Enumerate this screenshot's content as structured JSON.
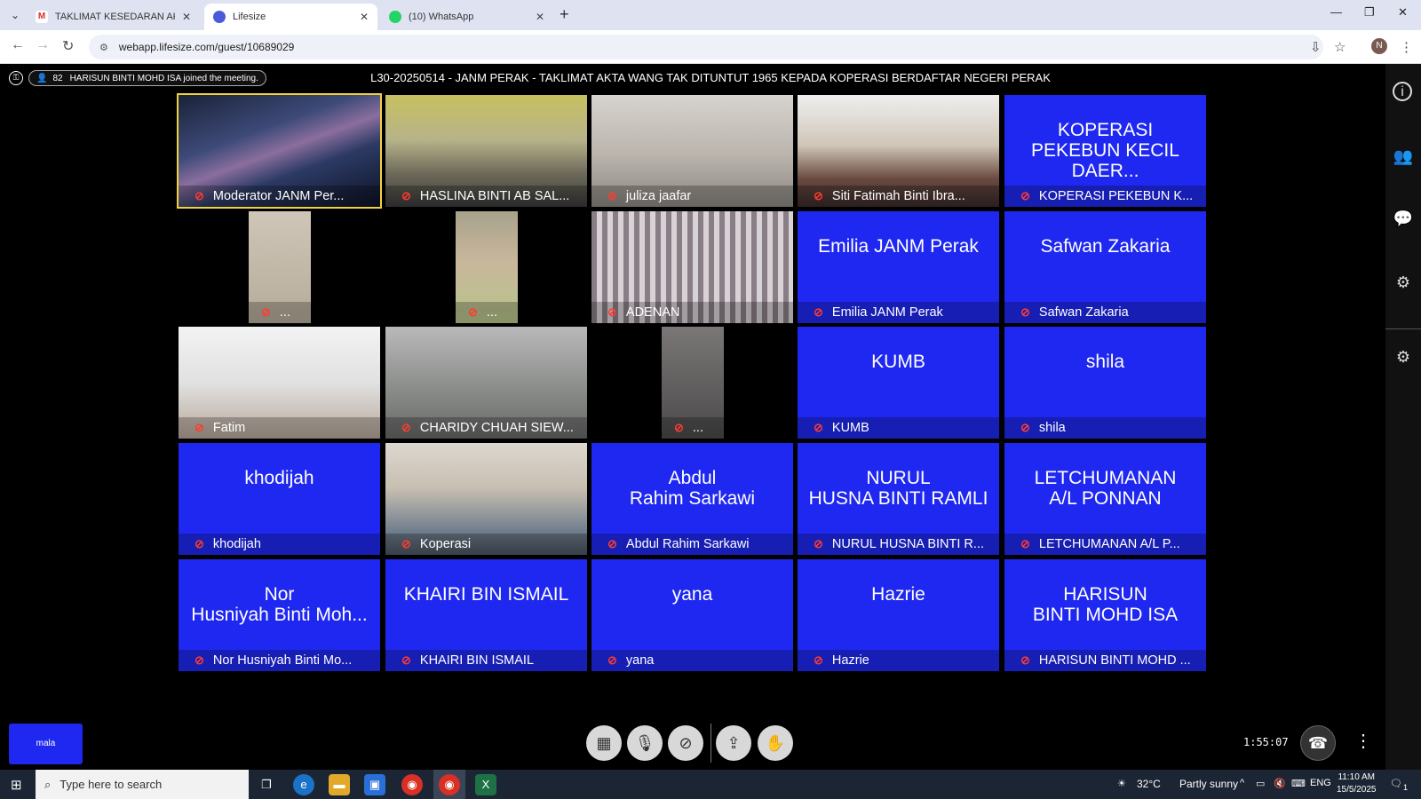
{
  "browser": {
    "tabs": [
      {
        "title": "TAKLIMAT KESEDARAN AKTA WANG",
        "icon": "gmail-icon",
        "color": "#d93025"
      },
      {
        "title": "Lifesize",
        "icon": "lifesize-icon",
        "color": "#4b5bd8"
      },
      {
        "title": "(10) WhatsApp",
        "icon": "whatsapp-icon",
        "color": "#25d366"
      }
    ],
    "url": "webapp.lifesize.com/guest/10689029",
    "profile_initial": "N"
  },
  "meeting": {
    "participant_count": "82",
    "join_notice": "HARISUN BINTI MOHD ISA joined the meeting.",
    "title": "L30-20250514 - JANM PERAK - TAKLIMAT AKTA WANG TAK DITUNTUT 1965 KEPADA KOPERASI BERDAFTAR NEGERI PERAK",
    "timer": "1:55:07",
    "self_view_name": "mala"
  },
  "participants": [
    {
      "name": "Moderator JANM Per...",
      "big": "",
      "type": "video",
      "scene": "galaxy"
    },
    {
      "name": "HASLINA BINTI AB SAL...",
      "big": "",
      "type": "video",
      "scene": "office"
    },
    {
      "name": "juliza jaafar",
      "big": "",
      "type": "video",
      "scene": "room"
    },
    {
      "name": "Siti Fatimah Binti Ibra...",
      "big": "",
      "type": "video",
      "scene": "face"
    },
    {
      "name": "KOPERASI PEKEBUN K...",
      "big": "KOPERASI\nPEKEBUN KECIL DAER...",
      "type": "blue"
    },
    {
      "name": "...",
      "big": "",
      "type": "video",
      "scene": "door"
    },
    {
      "name": "...",
      "big": "",
      "type": "video",
      "scene": "man"
    },
    {
      "name": "ADENAN",
      "big": "",
      "type": "video",
      "scene": "curtain"
    },
    {
      "name": "Emilia JANM Perak",
      "big": "Emilia JANM Perak",
      "type": "blue"
    },
    {
      "name": "Safwan Zakaria",
      "big": "Safwan Zakaria",
      "type": "blue"
    },
    {
      "name": "Fatim",
      "big": "",
      "type": "video",
      "scene": "ceiling"
    },
    {
      "name": "CHARIDY CHUAH SIEW...",
      "big": "",
      "type": "video",
      "scene": "stairs"
    },
    {
      "name": "...",
      "big": "",
      "type": "video",
      "scene": "dim"
    },
    {
      "name": "KUMB",
      "big": "KUMB",
      "type": "blue"
    },
    {
      "name": "shila",
      "big": "shila",
      "type": "blue"
    },
    {
      "name": "khodijah",
      "big": "khodijah",
      "type": "blue"
    },
    {
      "name": "Koperasi",
      "big": "",
      "type": "video",
      "scene": "hijab"
    },
    {
      "name": "Abdul Rahim Sarkawi",
      "big": "Abdul\nRahim Sarkawi",
      "type": "blue"
    },
    {
      "name": "NURUL HUSNA BINTI R...",
      "big": "NURUL\nHUSNA BINTI RAMLI",
      "type": "blue"
    },
    {
      "name": "LETCHUMANAN A/L P...",
      "big": "LETCHUMANAN\nA/L PONNAN",
      "type": "blue"
    },
    {
      "name": "Nor Husniyah Binti Mo...",
      "big": "Nor\nHusniyah Binti Moh...",
      "type": "blue"
    },
    {
      "name": "KHAIRI BIN ISMAIL",
      "big": "KHAIRI BIN ISMAIL",
      "type": "blue"
    },
    {
      "name": "yana",
      "big": "yana",
      "type": "blue"
    },
    {
      "name": "Hazrie",
      "big": "Hazrie",
      "type": "blue"
    },
    {
      "name": "HARISUN BINTI MOHD ...",
      "big": "HARISUN\nBINTI MOHD ISA",
      "type": "blue"
    }
  ],
  "taskbar": {
    "search_placeholder": "Type here to search",
    "temperature": "32°C",
    "weather": "Partly sunny",
    "language": "ENG",
    "time": "11:10 AM",
    "date": "15/5/2025",
    "notification_count": "1"
  },
  "colors": {
    "tile_blue": "#1f28f0",
    "highlight": "#f2d23c",
    "mute_red": "#ff3b30"
  }
}
